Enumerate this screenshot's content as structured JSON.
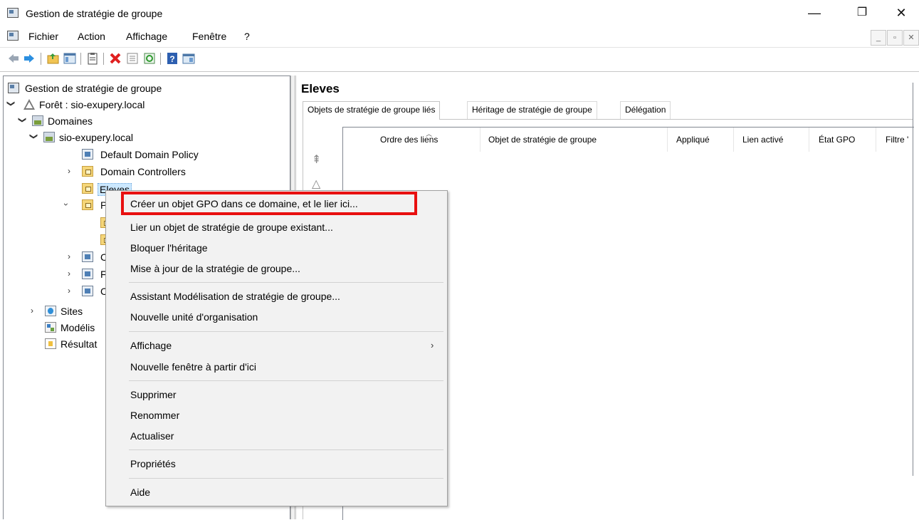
{
  "window": {
    "title": "Gestion de stratégie de groupe",
    "controls": {
      "minimize": "—",
      "restore": "❐",
      "close": "✕"
    }
  },
  "menubar": {
    "items": [
      "Fichier",
      "Action",
      "Affichage",
      "Fenêtre",
      "?"
    ]
  },
  "mdi_controls": {
    "minimize": "_",
    "restore": "▫",
    "close": "✕"
  },
  "toolbar": {
    "buttons": [
      "back-icon",
      "forward-icon",
      "up-folder-icon",
      "show-tree-icon",
      "copy-icon",
      "delete-icon",
      "properties-icon",
      "refresh-icon",
      "help-icon",
      "console-icon"
    ]
  },
  "tree": {
    "root": "Gestion de stratégie de groupe",
    "forest": "Forêt : sio-exupery.local",
    "domains": "Domaines",
    "domain": "sio-exupery.local",
    "default_policy": "Default Domain Policy",
    "domain_controllers": "Domain Controllers",
    "eleves": "Eleves",
    "partial_p": "P",
    "partial_c1": "C",
    "partial_f": "F",
    "partial_c2": "C",
    "sites": "Sites",
    "modelisation": "Modélis",
    "resultats": "Résultat"
  },
  "right": {
    "title": "Eleves",
    "tabs": [
      "Objets de stratégie de groupe liés",
      "Héritage de stratégie de groupe",
      "Délégation"
    ],
    "columns": [
      "Ordre des liens",
      "Objet de stratégie de groupe",
      "Appliqué",
      "Lien activé",
      "État GPO",
      "Filtre '"
    ]
  },
  "context_menu": {
    "items": [
      "Créer un objet GPO dans ce domaine, et le lier ici...",
      "Lier un objet de stratégie de groupe existant...",
      "Bloquer l'héritage",
      "Mise à jour de la stratégie de groupe...",
      "Assistant Modélisation de stratégie de groupe...",
      "Nouvelle unité d'organisation",
      "Affichage",
      "Nouvelle fenêtre à partir d'ici",
      "Supprimer",
      "Renommer",
      "Actualiser",
      "Propriétés",
      "Aide"
    ],
    "submenu_arrow": "›",
    "highlight_color": "#e81010"
  }
}
